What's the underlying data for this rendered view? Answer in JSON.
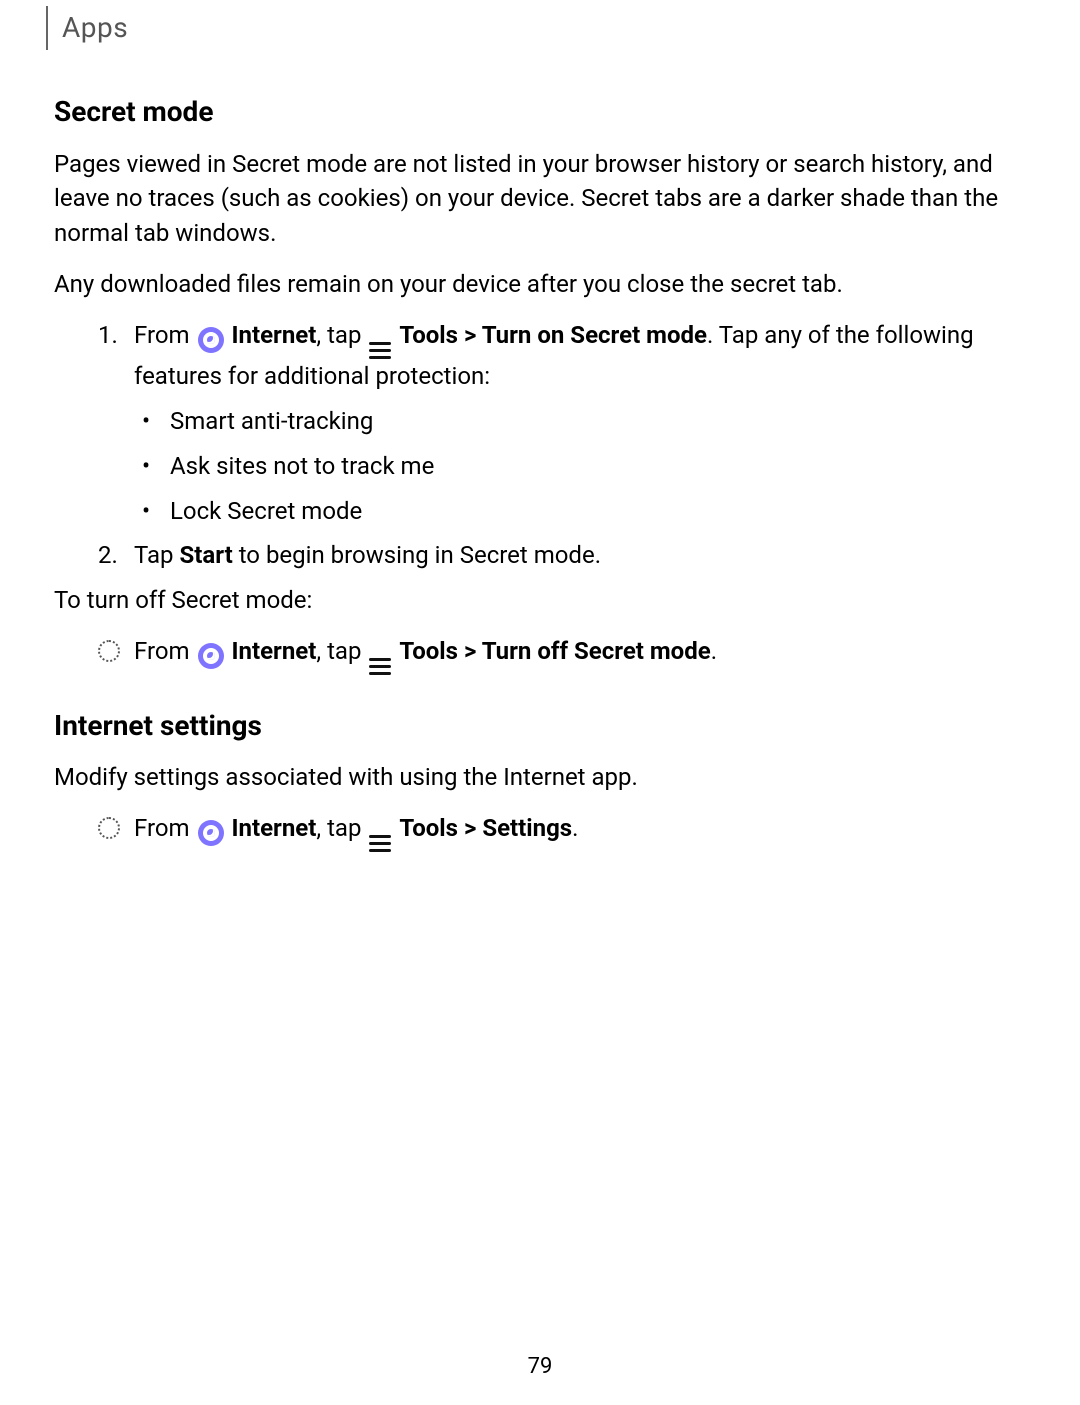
{
  "header": {
    "breadcrumb": "Apps"
  },
  "secret": {
    "title": "Secret mode",
    "intro1": "Pages viewed in Secret mode are not listed in your browser history or search history, and leave no traces (such as cookies) on your device. Secret tabs are a darker shade than the normal tab windows.",
    "intro2": "Any downloaded files remain on your device after you close the secret tab.",
    "step1": {
      "num": "1.",
      "pre": "From ",
      "internet_label": "Internet",
      "mid": ", tap ",
      "tools_label": "Tools",
      "chevron": " > ",
      "action": "Turn on Secret mode",
      "post": ". Tap any of the following features for additional protection:"
    },
    "features": {
      "a": "Smart anti-tracking",
      "b": "Ask sites not to track me",
      "c": "Lock Secret mode"
    },
    "step2": {
      "num": "2.",
      "pre": "Tap ",
      "start": "Start",
      "post": " to begin browsing in Secret mode."
    },
    "turn_off_intro": "To turn off Secret mode:",
    "turn_off": {
      "pre": "From ",
      "internet_label": "Internet",
      "mid": ", tap ",
      "tools_label": "Tools",
      "chevron": " > ",
      "action": "Turn off Secret mode",
      "period": "."
    }
  },
  "settings": {
    "title": "Internet settings",
    "intro": "Modify settings associated with using the Internet app.",
    "step": {
      "pre": "From ",
      "internet_label": "Internet",
      "mid": ", tap ",
      "tools_label": "Tools",
      "chevron": " > ",
      "action": "Settings",
      "period": "."
    }
  },
  "page_number": "79",
  "bullets": {
    "dot": "•"
  }
}
